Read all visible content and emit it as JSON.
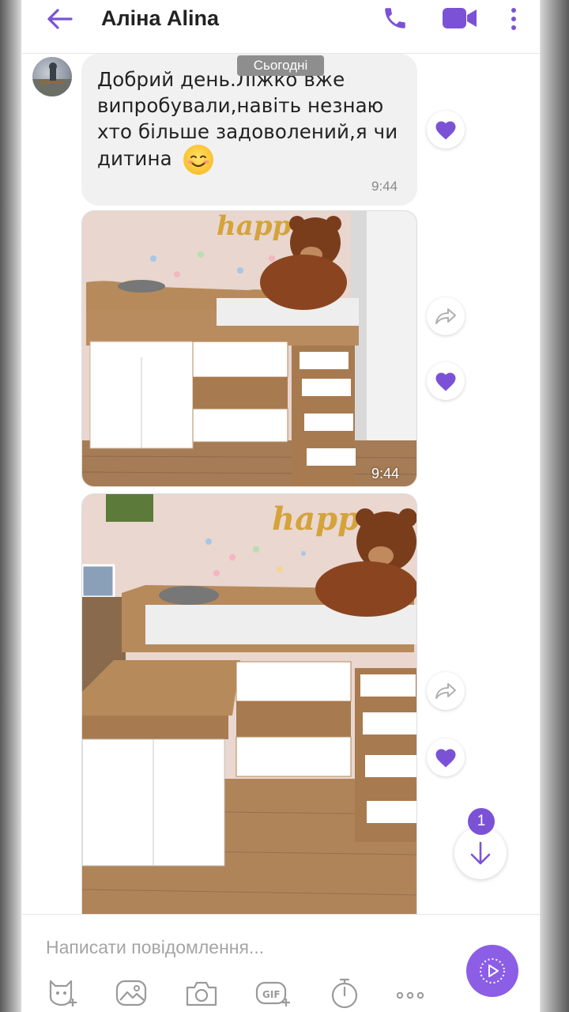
{
  "header": {
    "contact_name": "Аліна Alina",
    "back_icon": "arrow-left-icon",
    "call_icon": "phone-icon",
    "video_icon": "video-camera-icon",
    "menu_icon": "more-vertical-icon",
    "accent_color": "#7b52d6"
  },
  "chat": {
    "date_label": "Сьогодні",
    "messages": [
      {
        "type": "text",
        "text": "Добрий день.Ліжко вже випробували,навіть незнаю хто більше задоволений,я чи дитина",
        "emoji": "☺️",
        "time": "9:44",
        "liked": true
      },
      {
        "type": "image",
        "time": "9:44",
        "liked": true
      },
      {
        "type": "image",
        "liked": true
      }
    ],
    "unread_count": "1"
  },
  "composer": {
    "placeholder": "Написати повідомлення...",
    "tools": [
      "sticker-icon",
      "gallery-icon",
      "camera-icon",
      "gif-icon",
      "timer-icon",
      "more-horizontal-icon"
    ],
    "send_icon": "send-icon"
  }
}
